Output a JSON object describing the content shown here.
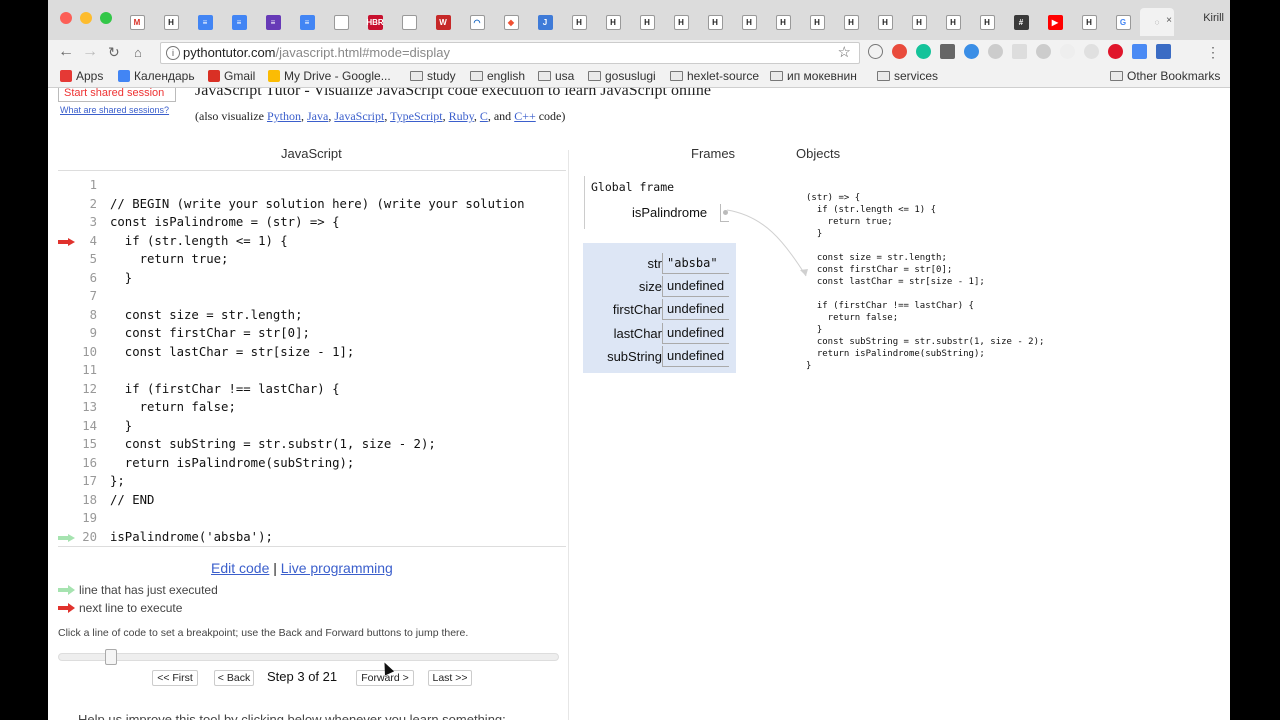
{
  "browser": {
    "profile_name": "Kirill",
    "url_host": "pythontutor.com",
    "url_path": "/javascript.html#mode=display",
    "tabs": [
      {
        "icon": "gmail-icon",
        "glyph": "M",
        "color": "#ffffff",
        "fg": "#d93025"
      },
      {
        "icon": "hexlet-icon",
        "glyph": "H",
        "color": "#ffffff",
        "fg": "#222222"
      },
      {
        "icon": "google-docs-icon",
        "glyph": "≡",
        "color": "#4285f4",
        "fg": "#ffffff"
      },
      {
        "icon": "google-docs-icon",
        "glyph": "≡",
        "color": "#4285f4",
        "fg": "#ffffff"
      },
      {
        "icon": "google-forms-icon",
        "glyph": "≡",
        "color": "#673ab7",
        "fg": "#ffffff"
      },
      {
        "icon": "google-docs-icon",
        "glyph": "≡",
        "color": "#4285f4",
        "fg": "#ffffff"
      },
      {
        "icon": "blank-page-icon",
        "glyph": "",
        "color": "#ffffff",
        "fg": "#888888"
      },
      {
        "icon": "hbr-icon",
        "glyph": "HBR",
        "color": "#c8102e",
        "fg": "#ffffff"
      },
      {
        "icon": "blank-page-icon",
        "glyph": "",
        "color": "#ffffff",
        "fg": "#888888"
      },
      {
        "icon": "w-icon",
        "glyph": "W",
        "color": "#c62828",
        "fg": "#ffffff"
      },
      {
        "icon": "wifi-icon",
        "glyph": "◠",
        "color": "#ffffff",
        "fg": "#1565c0"
      },
      {
        "icon": "git-icon",
        "glyph": "◆",
        "color": "#ffffff",
        "fg": "#f05133"
      },
      {
        "icon": "j-icon",
        "glyph": "J",
        "color": "#3f7bd8",
        "fg": "#ffffff"
      },
      {
        "icon": "hexlet-icon",
        "glyph": "H",
        "color": "#ffffff",
        "fg": "#222222"
      },
      {
        "icon": "hexlet-icon",
        "glyph": "H",
        "color": "#ffffff",
        "fg": "#222222"
      },
      {
        "icon": "hexlet-icon",
        "glyph": "H",
        "color": "#ffffff",
        "fg": "#222222"
      },
      {
        "icon": "hexlet-icon",
        "glyph": "H",
        "color": "#ffffff",
        "fg": "#222222"
      },
      {
        "icon": "hexlet-icon",
        "glyph": "H",
        "color": "#ffffff",
        "fg": "#222222"
      },
      {
        "icon": "hexlet-icon",
        "glyph": "H",
        "color": "#ffffff",
        "fg": "#222222"
      },
      {
        "icon": "hexlet-icon",
        "glyph": "H",
        "color": "#ffffff",
        "fg": "#222222"
      },
      {
        "icon": "hexlet-icon",
        "glyph": "H",
        "color": "#ffffff",
        "fg": "#222222"
      },
      {
        "icon": "hexlet-icon",
        "glyph": "H",
        "color": "#ffffff",
        "fg": "#222222"
      },
      {
        "icon": "hexlet-icon",
        "glyph": "H",
        "color": "#ffffff",
        "fg": "#222222"
      },
      {
        "icon": "hexlet-icon",
        "glyph": "H",
        "color": "#ffffff",
        "fg": "#222222"
      },
      {
        "icon": "hexlet-icon",
        "glyph": "H",
        "color": "#ffffff",
        "fg": "#222222"
      },
      {
        "icon": "hexlet-icon",
        "glyph": "H",
        "color": "#ffffff",
        "fg": "#222222"
      },
      {
        "icon": "hash-icon",
        "glyph": "#",
        "color": "#3a3a3a",
        "fg": "#ffffff"
      },
      {
        "icon": "youtube-icon",
        "glyph": "▶",
        "color": "#ff0000",
        "fg": "#ffffff"
      },
      {
        "icon": "hexlet-icon",
        "glyph": "H",
        "color": "#ffffff",
        "fg": "#222222"
      },
      {
        "icon": "google-icon",
        "glyph": "G",
        "color": "#ffffff",
        "fg": "#4285f4"
      },
      {
        "icon": "loading-icon",
        "glyph": "◌",
        "color": "#f2f2f2",
        "fg": "#666666",
        "active": true
      }
    ],
    "bookmarks": [
      {
        "label": "Apps",
        "icon": "apps-grid-icon"
      },
      {
        "label": "Календарь",
        "icon": "calendar-icon"
      },
      {
        "label": "Gmail",
        "icon": "gmail-icon"
      },
      {
        "label": "My Drive - Google...",
        "icon": "google-drive-icon"
      },
      {
        "label": "study",
        "icon": "folder-icon"
      },
      {
        "label": "english",
        "icon": "folder-icon"
      },
      {
        "label": "usa",
        "icon": "folder-icon"
      },
      {
        "label": "gosuslugi",
        "icon": "folder-icon"
      },
      {
        "label": "hexlet-source",
        "icon": "folder-icon"
      },
      {
        "label": "ип мокевнин",
        "icon": "folder-icon"
      },
      {
        "label": "services",
        "icon": "folder-icon"
      }
    ],
    "other_bookmarks": "Other Bookmarks",
    "colors": {
      "close": "#fc5f57",
      "minimize": "#fdbc2e",
      "maximize": "#33c748"
    }
  },
  "page": {
    "shared_session_button": "Start shared session",
    "shared_sessions_link": "What are shared sessions?",
    "title": "JavaScript Tutor - Visualize JavaScript code execution to learn JavaScript online",
    "also_prefix": "(also visualize ",
    "also_links": [
      "Python",
      "Java",
      "JavaScript",
      "TypeScript",
      "Ruby",
      "C",
      "C++"
    ],
    "also_suffix": " code)",
    "javascript_header": "JavaScript",
    "frames_header": "Frames",
    "objects_header": "Objects",
    "code_lines": [
      {
        "num": "1",
        "code": ""
      },
      {
        "num": "2",
        "code": "// BEGIN (write your solution here) (write your solution"
      },
      {
        "num": "3",
        "code": "const isPalindrome = (str) => {"
      },
      {
        "num": "4",
        "code": "  if (str.length <= 1) {",
        "marker": "next"
      },
      {
        "num": "5",
        "code": "    return true;"
      },
      {
        "num": "6",
        "code": "  }"
      },
      {
        "num": "7",
        "code": ""
      },
      {
        "num": "8",
        "code": "  const size = str.length;"
      },
      {
        "num": "9",
        "code": "  const firstChar = str[0];"
      },
      {
        "num": "10",
        "code": "  const lastChar = str[size - 1];"
      },
      {
        "num": "11",
        "code": ""
      },
      {
        "num": "12",
        "code": "  if (firstChar !== lastChar) {"
      },
      {
        "num": "13",
        "code": "    return false;"
      },
      {
        "num": "14",
        "code": "  }"
      },
      {
        "num": "15",
        "code": "  const subString = str.substr(1, size - 2);"
      },
      {
        "num": "16",
        "code": "  return isPalindrome(subString);"
      },
      {
        "num": "17",
        "code": "};"
      },
      {
        "num": "18",
        "code": "// END"
      },
      {
        "num": "19",
        "code": ""
      },
      {
        "num": "20",
        "code": "isPalindrome('absba');",
        "marker": "executed"
      }
    ],
    "edit_code": "Edit code",
    "separator": "|",
    "live_programming": "Live programming",
    "legend_executed": "line that has just executed",
    "legend_next": "next line to execute",
    "hint": "Click a line of code to set a breakpoint; use the Back and Forward buttons to jump there.",
    "step_progress": 0.095,
    "buttons": {
      "first": "<< First",
      "back": "< Back",
      "forward": "Forward >",
      "last": "Last >>"
    },
    "step_text": "Step 3 of 21",
    "bottom_text": "Help us improve this tool by clicking below whenever you learn something:",
    "marker_colors": {
      "executed": "#a6e3b0",
      "next": "#e0322d"
    }
  },
  "frames": {
    "global_label": "Global frame",
    "global_vars": [
      {
        "name": "isPalindrome"
      }
    ],
    "local_vars": [
      {
        "name": "str",
        "value": "\"absba\"",
        "kind": "str"
      },
      {
        "name": "size",
        "value": "undefined"
      },
      {
        "name": "firstChar",
        "value": "undefined"
      },
      {
        "name": "lastChar",
        "value": "undefined"
      },
      {
        "name": "subString",
        "value": "undefined"
      }
    ]
  },
  "objects": {
    "function_source": "(str) => {\n  if (str.length <= 1) {\n    return true;\n  }\n\n  const size = str.length;\n  const firstChar = str[0];\n  const lastChar = str[size - 1];\n\n  if (firstChar !== lastChar) {\n    return false;\n  }\n  const subString = str.substr(1, size - 2);\n  return isPalindrome(subString);\n}"
  }
}
